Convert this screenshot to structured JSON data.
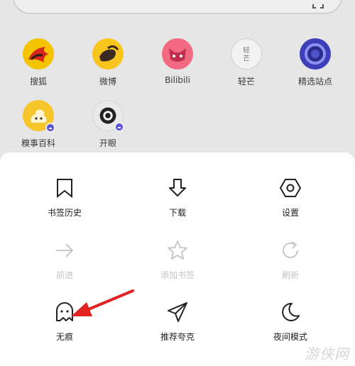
{
  "shortcuts": [
    {
      "label": "搜狐",
      "icon": "sohu-fox-icon"
    },
    {
      "label": "微博",
      "icon": "weibo-icon"
    },
    {
      "label": "Bilibili",
      "icon": "bilibili-icon"
    },
    {
      "label": "轻芒",
      "icon_text": "轻\n芒",
      "icon": "qingmang-icon"
    },
    {
      "label": "精选站点",
      "icon": "featured-sites-icon"
    },
    {
      "label": "糗事百科",
      "icon": "qiushibaike-icon"
    },
    {
      "label": "开眼",
      "icon": "kaiyan-eye-icon"
    }
  ],
  "menu": {
    "items": [
      {
        "label": "书签历史",
        "icon": "bookmark-icon",
        "enabled": true
      },
      {
        "label": "下载",
        "icon": "download-icon",
        "enabled": true
      },
      {
        "label": "设置",
        "icon": "settings-hexagon-icon",
        "enabled": true
      },
      {
        "label": "前进",
        "icon": "forward-arrow-icon",
        "enabled": false
      },
      {
        "label": "添加书签",
        "icon": "star-icon",
        "enabled": false
      },
      {
        "label": "刷新",
        "icon": "refresh-icon",
        "enabled": false
      },
      {
        "label": "无痕",
        "icon": "ghost-icon",
        "enabled": true
      },
      {
        "label": "推荐夸克",
        "icon": "paper-plane-icon",
        "enabled": true
      },
      {
        "label": "夜间模式",
        "icon": "moon-icon",
        "enabled": true
      }
    ]
  },
  "annotation": {
    "type": "arrow",
    "color": "#e32323",
    "points_to": "无痕"
  },
  "watermark": {
    "text": "游侠网"
  },
  "colors": {
    "menu_bg": "#ffffff",
    "backdrop": "#e6e6e6",
    "arrow": "#e32323",
    "badge": "#5a55d8"
  }
}
